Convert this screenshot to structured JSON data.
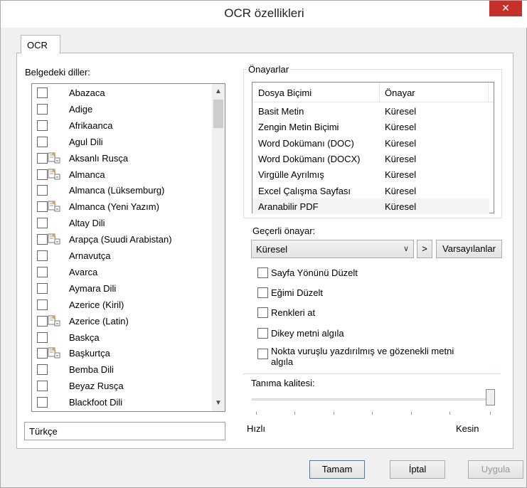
{
  "window": {
    "title": "OCR özellikleri",
    "close_label": "✕"
  },
  "tab": {
    "label": "OCR"
  },
  "languages": {
    "label": "Belgedeki diller:",
    "items": [
      {
        "name": "Abazaca",
        "icon": false
      },
      {
        "name": "Adige",
        "icon": false
      },
      {
        "name": "Afrikaanca",
        "icon": false
      },
      {
        "name": "Agul Dili",
        "icon": false
      },
      {
        "name": "Aksanlı Rusça",
        "icon": true
      },
      {
        "name": "Almanca",
        "icon": true
      },
      {
        "name": "Almanca (Lüksemburg)",
        "icon": false
      },
      {
        "name": "Almanca (Yeni Yazım)",
        "icon": true
      },
      {
        "name": "Altay Dili",
        "icon": false
      },
      {
        "name": "Arapça (Suudi Arabistan)",
        "icon": true
      },
      {
        "name": "Arnavutça",
        "icon": false
      },
      {
        "name": "Avarca",
        "icon": false
      },
      {
        "name": "Aymara Dili",
        "icon": false
      },
      {
        "name": "Azerice (Kiril)",
        "icon": false
      },
      {
        "name": "Azerice (Latin)",
        "icon": true
      },
      {
        "name": "Baskça",
        "icon": false
      },
      {
        "name": "Başkurtça",
        "icon": true
      },
      {
        "name": "Bemba Dili",
        "icon": false
      },
      {
        "name": "Beyaz Rusça",
        "icon": false
      },
      {
        "name": "Blackfoot Dili",
        "icon": false
      }
    ],
    "selected_value": "Türkçe"
  },
  "presets": {
    "group_label": "Önayarlar",
    "columns": [
      "Dosya Biçimi",
      "Önayar"
    ],
    "rows": [
      [
        "Basit Metin",
        "Küresel"
      ],
      [
        "Zengin Metin Biçimi",
        "Küresel"
      ],
      [
        "Word Dokümanı (DOC)",
        "Küresel"
      ],
      [
        "Word Dokümanı (DOCX)",
        "Küresel"
      ],
      [
        "Virgülle Ayrılmış",
        "Küresel"
      ],
      [
        "Excel Çalışma Sayfası",
        "Küresel"
      ],
      [
        "Aranabilir PDF",
        "Küresel"
      ]
    ],
    "selected_row": 6
  },
  "current_preset": {
    "label": "Geçerli önayar:",
    "value": "Küresel",
    "arrow_label": ">",
    "defaults_label": "Varsayılanlar"
  },
  "options": [
    {
      "label": "Sayfa Yönünü Düzelt",
      "checked": false
    },
    {
      "label": "Eğimi Düzelt",
      "checked": false
    },
    {
      "label": "Renkleri at",
      "checked": false
    },
    {
      "label": "Dikey metni algıla",
      "checked": false
    },
    {
      "label": "Nokta vuruşlu yazdırılmış ve gözenekli metni",
      "label2": "algıla",
      "checked": false
    }
  ],
  "quality": {
    "label": "Tanıma kalitesi:",
    "min_label": "Hızlı",
    "max_label": "Kesin",
    "level": 1.0
  },
  "footer": {
    "ok": "Tamam",
    "cancel": "İptal",
    "apply": "Uygula"
  }
}
